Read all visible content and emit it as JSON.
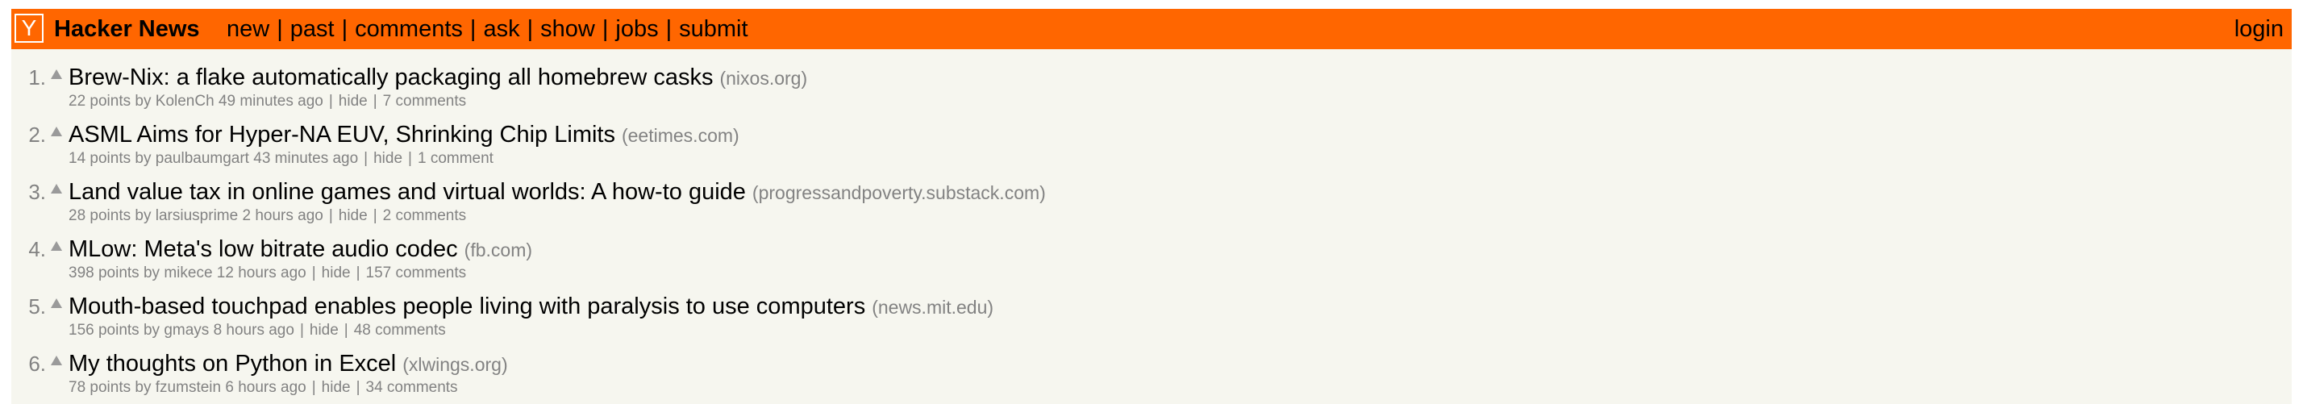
{
  "header": {
    "logo_letter": "Y",
    "site_name": "Hacker News",
    "nav": [
      "new",
      "past",
      "comments",
      "ask",
      "show",
      "jobs",
      "submit"
    ],
    "separator": "|",
    "login": "login",
    "colors": {
      "bar": "#ff6600",
      "page_bg": "#f6f6ef",
      "muted": "#828282"
    }
  },
  "stories": [
    {
      "rank": "1.",
      "title": "Brew-Nix: a flake automatically packaging all homebrew casks",
      "site": "(nixos.org)",
      "score": "22 points",
      "by": "by",
      "user": "KolenCh",
      "age": "49 minutes ago",
      "hide": "hide",
      "comments": "7 comments"
    },
    {
      "rank": "2.",
      "title": "ASML Aims for Hyper-NA EUV, Shrinking Chip Limits",
      "site": "(eetimes.com)",
      "score": "14 points",
      "by": "by",
      "user": "paulbaumgart",
      "age": "43 minutes ago",
      "hide": "hide",
      "comments": "1 comment"
    },
    {
      "rank": "3.",
      "title": "Land value tax in online games and virtual worlds: A how-to guide",
      "site": "(progressandpoverty.substack.com)",
      "score": "28 points",
      "by": "by",
      "user": "larsiusprime",
      "age": "2 hours ago",
      "hide": "hide",
      "comments": "2 comments"
    },
    {
      "rank": "4.",
      "title": "MLow: Meta's low bitrate audio codec",
      "site": "(fb.com)",
      "score": "398 points",
      "by": "by",
      "user": "mikece",
      "age": "12 hours ago",
      "hide": "hide",
      "comments": "157 comments"
    },
    {
      "rank": "5.",
      "title": "Mouth-based touchpad enables people living with paralysis to use computers",
      "site": "(news.mit.edu)",
      "score": "156 points",
      "by": "by",
      "user": "gmays",
      "age": "8 hours ago",
      "hide": "hide",
      "comments": "48 comments"
    },
    {
      "rank": "6.",
      "title": "My thoughts on Python in Excel",
      "site": "(xlwings.org)",
      "score": "78 points",
      "by": "by",
      "user": "fzumstein",
      "age": "6 hours ago",
      "hide": "hide",
      "comments": "34 comments"
    }
  ]
}
